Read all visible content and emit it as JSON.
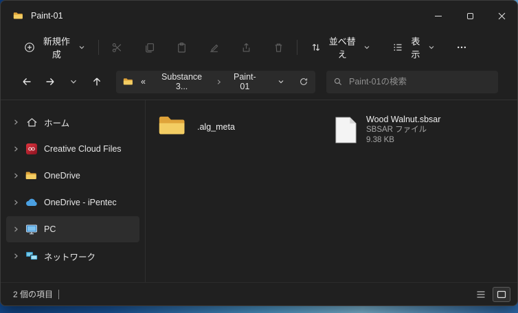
{
  "window": {
    "title": "Paint-01"
  },
  "toolbar": {
    "new_label": "新規作成",
    "sort_label": "並べ替え",
    "view_label": "表示"
  },
  "navbar": {
    "breadcrumb_overflow": "«",
    "breadcrumb_segments": [
      "Substance 3...",
      "Paint-01"
    ],
    "search_placeholder": "Paint-01の検索"
  },
  "sidebar": {
    "items": [
      {
        "label": "ホーム",
        "icon": "home-icon"
      },
      {
        "label": "Creative Cloud Files",
        "icon": "creative-cloud-icon"
      },
      {
        "label": "OneDrive",
        "icon": "folder-icon"
      },
      {
        "label": "OneDrive - iPentec",
        "icon": "cloud-icon"
      },
      {
        "label": "PC",
        "icon": "pc-icon",
        "selected": true
      },
      {
        "label": "ネットワーク",
        "icon": "network-icon"
      }
    ]
  },
  "content": {
    "items": [
      {
        "name": ".alg_meta",
        "type": "folder"
      },
      {
        "name": "Wood Walnut.sbsar",
        "type": "file",
        "type_label": "SBSAR ファイル",
        "size": "9.38 KB"
      }
    ]
  },
  "statusbar": {
    "item_count": "2 個の項目"
  },
  "colors": {
    "window_bg": "#202020",
    "selection_bg": "#2d2d2d",
    "folder_front": "#f3cd63",
    "folder_back": "#dfa339",
    "accent_blue": "#4aa0e2"
  }
}
